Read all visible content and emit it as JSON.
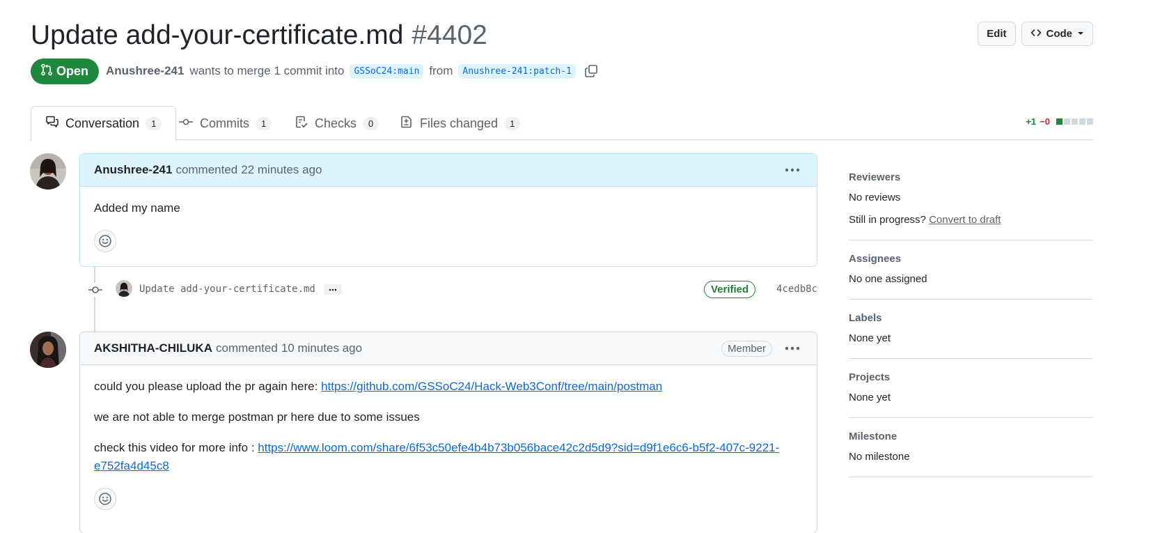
{
  "pr": {
    "title": "Update add-your-certificate.md",
    "number": "#4402",
    "state": "Open",
    "author": "Anushree-241",
    "merge_text": "wants to merge 1 commit into",
    "base_branch": "GSSoC24:main",
    "from_text": "from",
    "head_branch": "Anushree-241:patch-1"
  },
  "header_actions": {
    "edit_label": "Edit",
    "code_label": "Code"
  },
  "tabs": [
    {
      "label": "Conversation",
      "count": "1",
      "icon": "comment-discussion-icon"
    },
    {
      "label": "Commits",
      "count": "1",
      "icon": "git-commit-icon"
    },
    {
      "label": "Checks",
      "count": "0",
      "icon": "checklist-icon"
    },
    {
      "label": "Files changed",
      "count": "1",
      "icon": "file-diff-icon"
    }
  ],
  "diffstat": {
    "additions": "+1",
    "deletions": "−0",
    "add_color": "#1f883d",
    "neutral_color": "#d1d9e0"
  },
  "comments": [
    {
      "author": "Anushree-241",
      "action": "commented",
      "time": "22 minutes ago",
      "body": [
        "Added my name"
      ]
    },
    {
      "author": "AKSHITHA-CHILUKA",
      "action": "commented",
      "time": "10 minutes ago",
      "badge": "Member",
      "body_line1_text": "could you please upload the pr again here:",
      "body_line1_link": "https://github.com/GSSoC24/Hack-Web3Conf/tree/main/postman",
      "body_line2": "we are not able to merge postman pr here due to some issues",
      "body_line3_text": "check this video for more info :",
      "body_line3_link": "https://www.loom.com/share/6f53c50efe4b4b73b056bace42c2d5d9?sid=d9f1e6c6-b5f2-407c-9221-e752fa4d45c8"
    }
  ],
  "commit": {
    "message": "Update add-your-certificate.md",
    "ellipsis": "…",
    "verified": "Verified",
    "sha": "4cedb8c"
  },
  "sidebar": {
    "reviewers": {
      "title": "Reviewers",
      "value": "No reviews",
      "draft_text": "Still in progress?",
      "draft_link": "Convert to draft"
    },
    "assignees": {
      "title": "Assignees",
      "value": "No one assigned"
    },
    "labels": {
      "title": "Labels",
      "value": "None yet"
    },
    "projects": {
      "title": "Projects",
      "value": "None yet"
    },
    "milestone": {
      "title": "Milestone",
      "value": "No milestone"
    }
  },
  "colors": {
    "open_green": "#1f883d",
    "link_blue": "#0969da",
    "self_comment_header": "#ddf4ff",
    "border": "#d1d9e0"
  }
}
